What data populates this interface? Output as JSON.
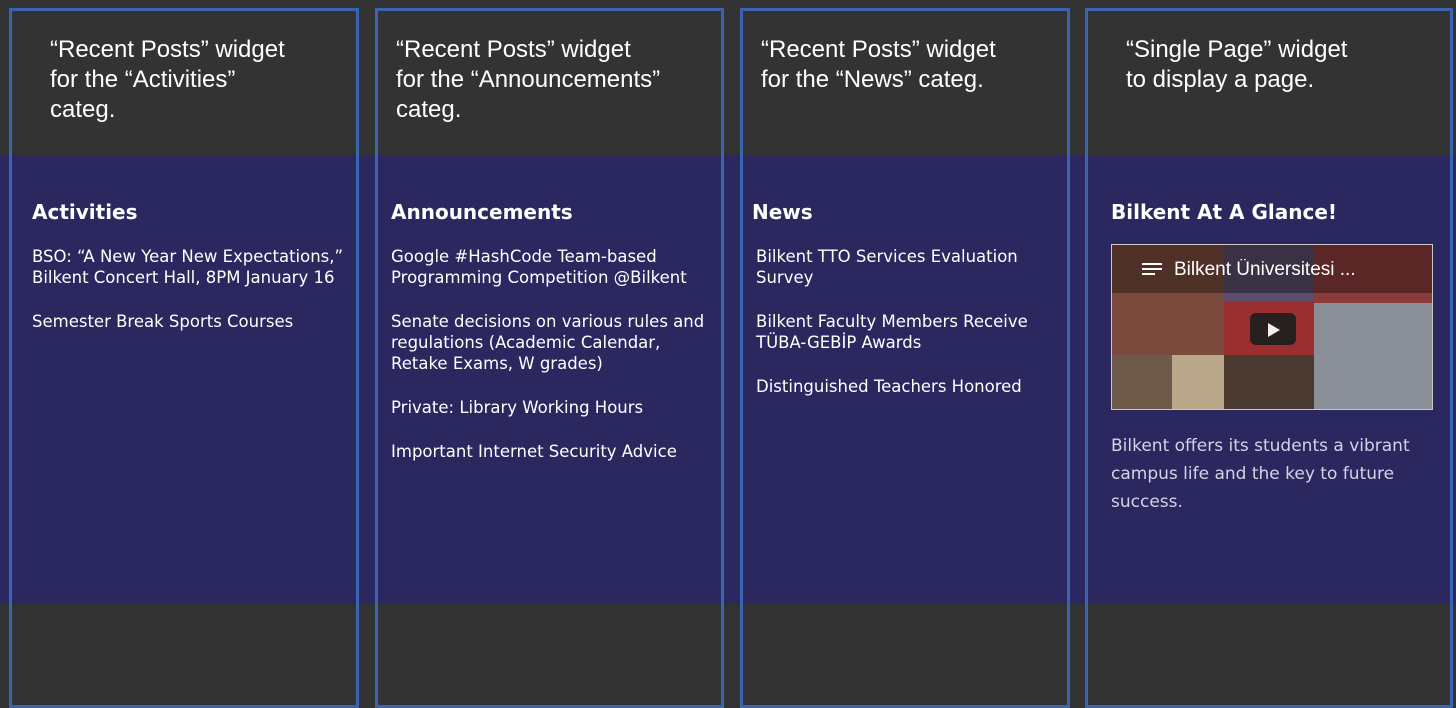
{
  "captions": [
    "“Recent Posts” widget\nfor the “Activities”\ncateg.",
    "“Recent Posts” widget\nfor the “Announcements”\ncateg.",
    "“Recent Posts” widget\nfor the “News” categ.",
    "“Single Page” widget\nto display a page."
  ],
  "activities": {
    "title": "Activities",
    "posts": [
      "BSO: “A New Year New Expectations,” Bilkent Concert Hall, 8PM January 16",
      "Semester Break Sports Courses"
    ]
  },
  "announcements": {
    "title": "Announcements",
    "posts": [
      "Google #HashCode Team-based Programming Competition @Bilkent",
      "Senate decisions on various rules and regulations (Academic Calendar, Retake Exams, W grades)",
      "Private: Library Working Hours",
      "Important Internet Security Advice"
    ]
  },
  "news": {
    "title": "News",
    "posts": [
      "Bilkent TTO Services Evaluation Survey",
      "Bilkent Faculty Members Receive TÜBA-GEBİP Awards",
      "Distinguished Teachers Honored"
    ]
  },
  "page_widget": {
    "title": "Bilkent At A Glance!",
    "video_title": "Bilkent Üniversitesi ...",
    "video_icon": "playlist-icon",
    "play_icon": "play-icon",
    "description": "Bilkent offers its students a vibrant campus life and the key to future success."
  },
  "colors": {
    "dark_bg": "#333333",
    "widget_bg": "#2b2860",
    "frame_border": "#3a63b0"
  }
}
